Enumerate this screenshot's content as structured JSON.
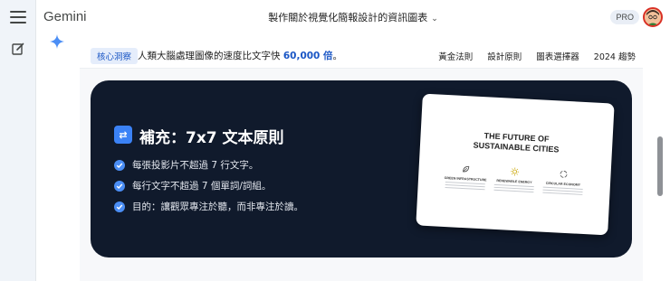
{
  "app": {
    "brand": "Gemini",
    "conversation_title": "製作關於視覺化簡報設計的資訊圖表",
    "plan_badge": "PRO"
  },
  "rail": {
    "menu_icon": "hamburger-menu-icon",
    "new_chat_icon": "edit-icon"
  },
  "strip": {
    "badge": "核心洞察",
    "headline_prefix": "人類大腦處理圖像的速度比文字快 ",
    "headline_number": "60,000 倍",
    "headline_suffix": "。",
    "nav": [
      "黃金法則",
      "設計原則",
      "圖表選擇器",
      "2024 趨勢"
    ]
  },
  "card": {
    "icon": "⇄",
    "title": "補充：7x7 文本原則",
    "bullets": [
      "每張投影片不超過 7 行文字。",
      "每行文字不超過 7 個單詞/詞組。",
      "目的：讓觀眾專注於聽，而非專注於讀。"
    ]
  },
  "slide": {
    "title_line1": "THE FUTURE OF",
    "title_line2": "SUSTAINABLE CITIES",
    "columns": [
      "GREEN INFRASTRUCTURE",
      "RENEWABLE ENERGY",
      "CIRCULAR ECONOMY"
    ]
  },
  "colors": {
    "card_bg": "#101a2c",
    "accent": "#1a56c5",
    "check": "#4b8ef5"
  }
}
